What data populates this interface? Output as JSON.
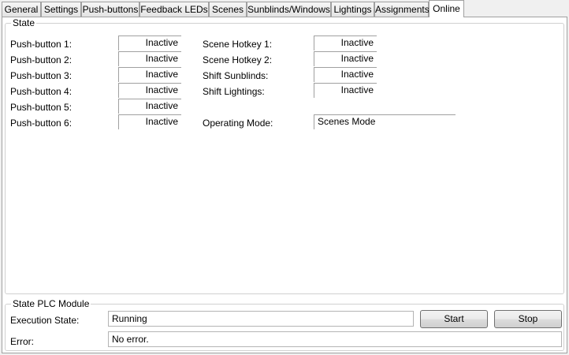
{
  "tabs": [
    {
      "label": "General"
    },
    {
      "label": "Settings"
    },
    {
      "label": "Push-buttons"
    },
    {
      "label": "Feedback LEDs"
    },
    {
      "label": "Scenes"
    },
    {
      "label": "Sunblinds/Windows"
    },
    {
      "label": "Lightings"
    },
    {
      "label": "Assignments"
    },
    {
      "label": "Online"
    }
  ],
  "state": {
    "title": "State",
    "push_buttons": [
      {
        "label": "Push-button 1:",
        "value": "Inactive"
      },
      {
        "label": "Push-button 2:",
        "value": "Inactive"
      },
      {
        "label": "Push-button 3:",
        "value": "Inactive"
      },
      {
        "label": "Push-button 4:",
        "value": "Inactive"
      },
      {
        "label": "Push-button 5:",
        "value": "Inactive"
      },
      {
        "label": "Push-button 6:",
        "value": "Inactive"
      }
    ],
    "right": [
      {
        "label": "Scene Hotkey 1:",
        "value": "Inactive"
      },
      {
        "label": "Scene Hotkey 2:",
        "value": "Inactive"
      },
      {
        "label": "Shift Sunblinds:",
        "value": "Inactive"
      },
      {
        "label": "Shift Lightings:",
        "value": "Inactive"
      }
    ],
    "operating_mode": {
      "label": "Operating Mode:",
      "value": "Scenes Mode"
    }
  },
  "plc": {
    "title": "State PLC Module",
    "execution_label": "Execution State:",
    "execution_value": "Running",
    "error_label": "Error:",
    "error_value": "No error.",
    "start_label": "Start",
    "stop_label": "Stop"
  }
}
